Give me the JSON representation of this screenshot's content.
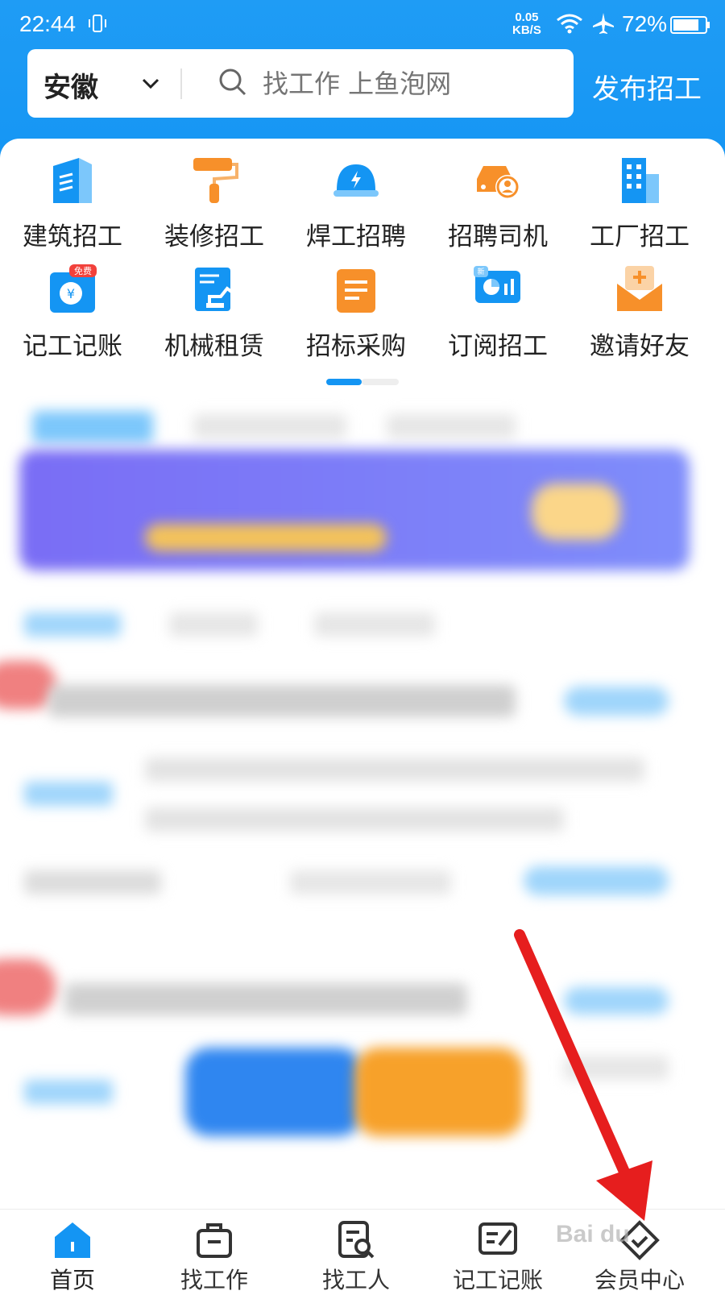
{
  "status_bar": {
    "time": "22:44",
    "net_speed_value": "0.05",
    "net_speed_unit": "KB/S",
    "battery": "72%"
  },
  "search": {
    "region": "安徽",
    "placeholder": "找工作 上鱼泡网",
    "post_button": "发布招工"
  },
  "categories": [
    {
      "label": "建筑招工",
      "icon": "building-icon"
    },
    {
      "label": "装修招工",
      "icon": "paint-roller-icon"
    },
    {
      "label": "焊工招聘",
      "icon": "hard-hat-icon"
    },
    {
      "label": "招聘司机",
      "icon": "car-driver-icon"
    },
    {
      "label": "工厂招工",
      "icon": "factory-icon"
    },
    {
      "label": "记工记账",
      "icon": "ledger-icon",
      "badge": "免费"
    },
    {
      "label": "机械租赁",
      "icon": "excavator-icon"
    },
    {
      "label": "招标采购",
      "icon": "document-icon"
    },
    {
      "label": "订阅招工",
      "icon": "chart-icon",
      "badge": "新"
    },
    {
      "label": "邀请好友",
      "icon": "envelope-icon"
    }
  ],
  "tabbar": [
    {
      "label": "首页",
      "icon": "home-icon",
      "active": true
    },
    {
      "label": "找工作",
      "icon": "briefcase-icon"
    },
    {
      "label": "找工人",
      "icon": "search-doc-icon"
    },
    {
      "label": "记工记账",
      "icon": "edit-note-icon"
    },
    {
      "label": "会员中心",
      "icon": "diamond-icon"
    }
  ],
  "colors": {
    "primary": "#1495f3",
    "orange": "#f7902a",
    "annotation_arrow": "#e61e1e"
  }
}
